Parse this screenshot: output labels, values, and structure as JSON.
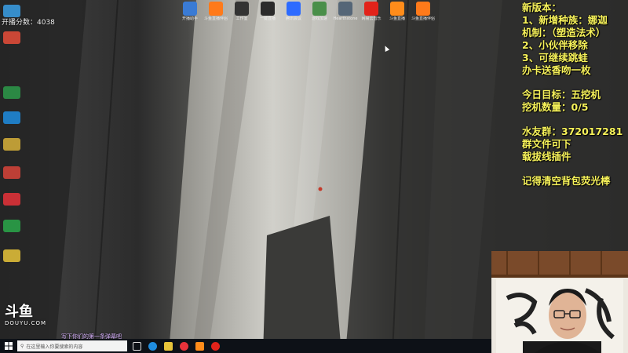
{
  "overlay": {
    "line1": "新版本：",
    "line2": "1、新增种族：娜迦",
    "line3": "机制：（塑造法术）",
    "line4": "2、小伙伴移除",
    "line5": "3、可继续跳蛙",
    "line6": "办卡送香吻一枚",
    "line7": "今日目标：五挖机",
    "line8": "挖机数量：0/5",
    "line9": "水友群：372017281",
    "line10": "群文件可下",
    "line11": "载拔线插件",
    "line12": "记得清空背包荧光棒",
    "color": "#f7f25a"
  },
  "stats": {
    "line1": "开播分数：4038"
  },
  "desktop_icons": [
    {
      "label": "开播助手",
      "color": "#3a7bd5",
      "icon": "live-app-icon"
    },
    {
      "label": "斗鱼直播伴侣",
      "color": "#ff7a1a",
      "icon": "douyu-icon"
    },
    {
      "label": "工作室",
      "color": "#333333",
      "icon": "studio-icon"
    },
    {
      "label": "一键直播",
      "color": "#2b2b2b",
      "icon": "camera-icon"
    },
    {
      "label": "腾讯会议",
      "color": "#2d6bff",
      "icon": "meeting-icon"
    },
    {
      "label": "游戏加速",
      "color": "#4a8f4a",
      "icon": "accelerator-icon"
    },
    {
      "label": "Hearthstone",
      "color": "#556677",
      "icon": "hearthstone-icon"
    },
    {
      "label": "网易云音乐",
      "color": "#e2231a",
      "icon": "music-icon"
    },
    {
      "label": "斗鱼直播",
      "color": "#ff8c1a",
      "icon": "douyu-live-icon"
    },
    {
      "label": "斗鱼直播伴侣",
      "color": "#ff7a1a",
      "icon": "douyu-partner-icon"
    }
  ],
  "left_icons": [
    {
      "color": "#3aa0e8",
      "icon": "recycle-bin-icon"
    },
    {
      "color": "#e84d3a",
      "icon": "app-icon"
    },
    {
      "color": "#2d9a4a",
      "icon": "app-icon"
    },
    {
      "color": "#1f8de0",
      "icon": "edge-icon"
    },
    {
      "color": "#d8b23a",
      "icon": "folder-icon"
    },
    {
      "color": "#d8443a",
      "icon": "app-icon"
    },
    {
      "color": "#e8323a",
      "icon": "app-icon"
    },
    {
      "color": "#2aa84a",
      "icon": "app-icon"
    },
    {
      "color": "#e8c43a",
      "icon": "yy-icon"
    }
  ],
  "taskbar": {
    "search_placeholder": "在这里输入你要搜索的内容"
  },
  "watermark": {
    "logo_text": "斗鱼",
    "url_text": "DOUYU.COM"
  },
  "danmu": {
    "text": "写下你们的第一条弹幕吧"
  }
}
